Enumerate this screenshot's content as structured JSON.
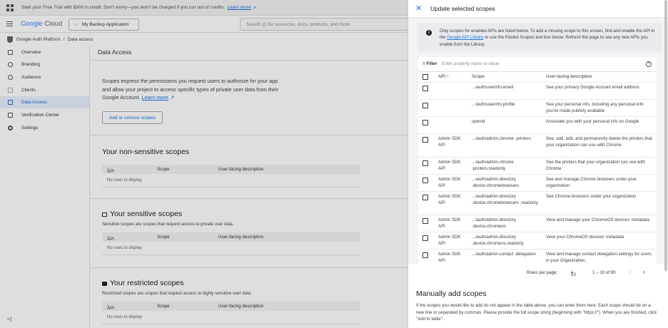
{
  "banner": {
    "text": "Start your Free Trial with $300 in credit. Don't worry—you won't be charged if you run out of credits.",
    "link": "Learn more"
  },
  "topbar": {
    "logo_google": "Google",
    "logo_cloud": "Cloud",
    "project": "My Backup Application",
    "search_placeholder": "Search (/) for resources, docs, products, and more"
  },
  "breadcrumb": {
    "parent": "Google Auth Platform",
    "sep": "/",
    "current": "Data access"
  },
  "sidebar": {
    "items": [
      {
        "label": "Overview",
        "icon": "dashboard-icon"
      },
      {
        "label": "Branding",
        "icon": "palette-icon"
      },
      {
        "label": "Audience",
        "icon": "person-icon"
      },
      {
        "label": "Clients",
        "icon": "grid-icon"
      },
      {
        "label": "Data Access",
        "icon": "data-access-icon",
        "active": true
      },
      {
        "label": "Verification Center",
        "icon": "verified-icon"
      },
      {
        "label": "Settings",
        "icon": "gear-icon"
      }
    ],
    "collapse": "<|"
  },
  "main": {
    "title": "Data Access",
    "intro": "Scopes express the permissions you request users to authorize for your app and allow your project to access specific types of private user data from their Google Account.",
    "intro_link": "Learn more",
    "add_button": "Add or remove scopes",
    "table_headers": {
      "api": "API",
      "scope": "Scope",
      "desc": "User-facing description"
    },
    "non_sensitive": {
      "title": "Your non-sensitive scopes",
      "empty": "No rows to display"
    },
    "sensitive": {
      "title": "Your sensitive scopes",
      "subtitle": "Sensitive scopes are scopes that request access to private user data.",
      "empty": "No rows to display"
    },
    "restricted": {
      "title": "Your restricted scopes",
      "subtitle": "Restricted scopes are scopes that request access to highly sensitive user data.",
      "empty": "No rows to display"
    }
  },
  "panel": {
    "title": "Update selected scopes",
    "info_a": "Only scopes for enabled APIs are listed below. To add a missing scope to this screen, find and enable the API in the",
    "info_link": "Google API Library",
    "info_b": "or use the Pasted Scopes text box below. Refresh the page to see any new APIs you enable from the Library.",
    "filter_label": "Filter",
    "filter_placeholder": "Enter property name or value",
    "headers": {
      "api": "API",
      "scope": "Scope",
      "desc": "User-facing description"
    },
    "rows": [
      {
        "api": "",
        "scope": ".../auth/userinfo.email",
        "desc": "See your primary Google Account email address"
      },
      {
        "api": "",
        "scope": ".../auth/userinfo.profile",
        "desc": "See your personal info, including any personal info you've made publicly available"
      },
      {
        "api": "",
        "scope": "openid",
        "desc": "Associate you with your personal info on Google"
      },
      {
        "api": "Admin SDK API",
        "scope": ".../auth/admin.chrome .printers",
        "desc": "See, add, edit, and permanently delete the printers that your organization can use with Chrome"
      },
      {
        "api": "Admin SDK API",
        "scope": ".../auth/admin.chrome .printers.readonly",
        "desc": "See the printers that your organization can use with Chrome"
      },
      {
        "api": "Admin SDK API",
        "scope": ".../auth/admin.directory .device.chromebrowsers",
        "desc": "See and manage Chrome browsers under your organization"
      },
      {
        "api": "Admin SDK API",
        "scope": ".../auth/admin.directory .device.chromebrowsers .readonly",
        "desc": "See Chrome browsers under your organization"
      },
      {
        "api": "Admin SDK API",
        "scope": ".../auth/admin.directory .device.chromeos",
        "desc": "View and manage your ChromeOS devices' metadata"
      },
      {
        "api": "Admin SDK API",
        "scope": ".../auth/admin.directory .device.chromeos.readonly",
        "desc": "View your ChromeOS devices' metadata"
      },
      {
        "api": "Admin SDK API",
        "scope": ".../auth/admin.contact .delegation",
        "desc": "View and manage contact delegation settings for users in your Organization."
      }
    ],
    "pagination": {
      "rows_label": "Rows per page:",
      "rows_value": "10",
      "range": "1 – 10 of 90"
    },
    "manual_title": "Manually add scopes",
    "manual_text": "If the scopes you would like to add do not appear in the table above, you can enter them here. Each scope should be on a new line or separated by commas. Please provide the full scope string (beginning with \"https://\"). When you are finished, click \"Add to table\"."
  }
}
